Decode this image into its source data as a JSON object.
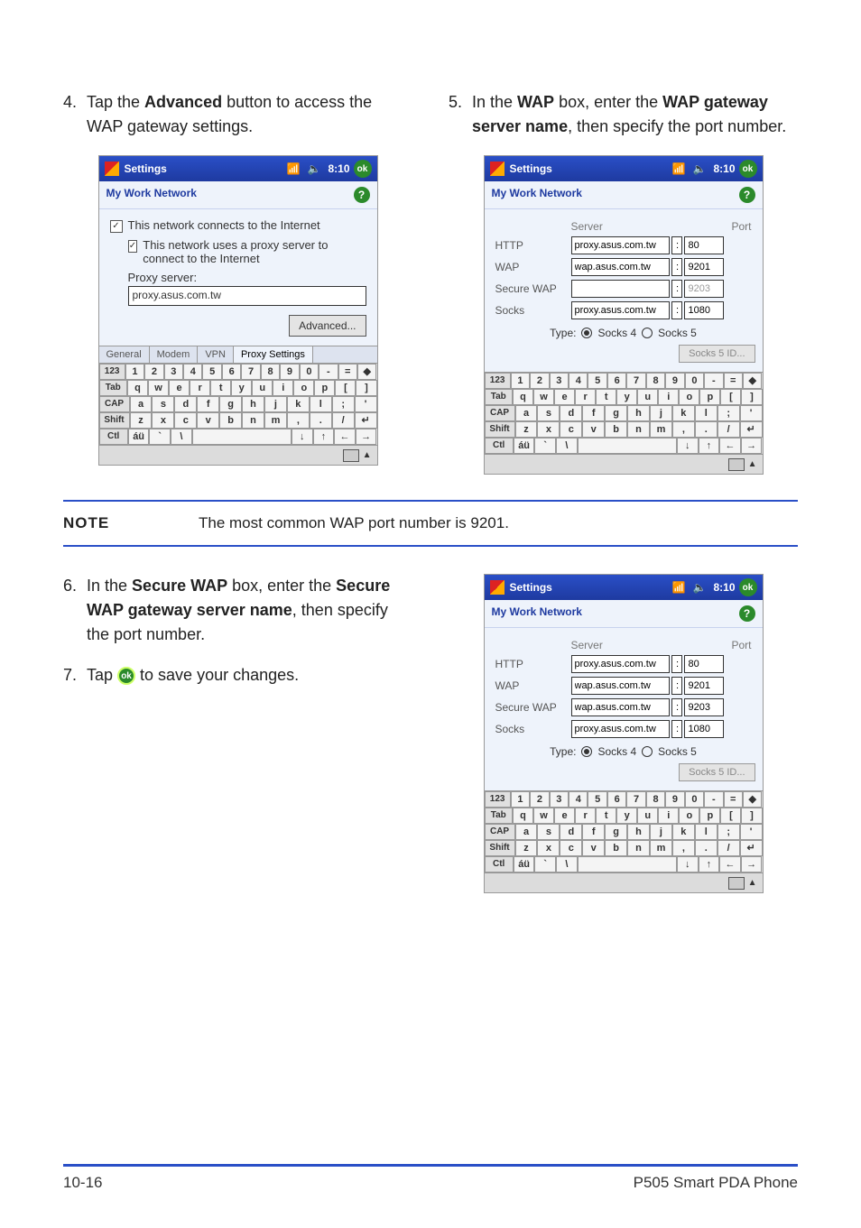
{
  "steps": {
    "s4": {
      "num": "4.",
      "pre": "Tap the ",
      "bold": "Advanced",
      "post": " button to access the WAP gateway settings."
    },
    "s5": {
      "num": "5.",
      "pre1": "In the ",
      "bold1": "WAP",
      "mid": " box, enter the ",
      "bold2": "WAP gateway server name",
      "post": ", then specify the port number."
    },
    "s6": {
      "num": "6.",
      "pre1": "In the ",
      "bold1": "Secure WAP",
      "mid": " box, enter the ",
      "bold2": "Secure WAP gateway server name",
      "post": ", then specify the port number."
    },
    "s7": {
      "num": "7.",
      "pre": "Tap ",
      "post": " to save your changes."
    }
  },
  "note": {
    "label": "NOTE",
    "text": "The most common WAP port number is 9201."
  },
  "titlebar": {
    "title": "Settings",
    "time": "8:10",
    "ok": "ok"
  },
  "subhead": {
    "title": "My Work Network",
    "help": "?"
  },
  "ss1": {
    "chk1": "This network connects to the Internet",
    "chk2": "This network uses a proxy server to connect to the Internet",
    "proxy_label": "Proxy server:",
    "proxy_value": "proxy.asus.com.tw",
    "advanced": "Advanced...",
    "tabs": {
      "t1": "General",
      "t2": "Modem",
      "t3": "VPN",
      "t4": "Proxy Settings"
    }
  },
  "proxyform": {
    "hdr_server": "Server",
    "hdr_port": "Port",
    "rows": {
      "http": {
        "label": "HTTP",
        "server": "proxy.asus.com.tw",
        "port": "80"
      },
      "wap": {
        "label": "WAP",
        "server": "wap.asus.com.tw",
        "port": "9201"
      },
      "secwap": {
        "label": "Secure WAP",
        "server": "",
        "port": "9203"
      },
      "secwap2": {
        "server": "wap.asus.com.tw",
        "port": "9203"
      },
      "socks": {
        "label": "Socks",
        "server": "proxy.asus.com.tw",
        "port": "1080"
      }
    },
    "colon": ":",
    "type_label": "Type:",
    "r1": "Socks 4",
    "r2": "Socks 5",
    "socks_btn": "Socks 5 ID..."
  },
  "kbd": {
    "r1": [
      "123",
      "1",
      "2",
      "3",
      "4",
      "5",
      "6",
      "7",
      "8",
      "9",
      "0",
      "-",
      "=",
      "◆"
    ],
    "r2": [
      "Tab",
      "q",
      "w",
      "e",
      "r",
      "t",
      "y",
      "u",
      "i",
      "o",
      "p",
      "[",
      "]"
    ],
    "r3": [
      "CAP",
      "a",
      "s",
      "d",
      "f",
      "g",
      "h",
      "j",
      "k",
      "l",
      ";",
      "'"
    ],
    "r4": [
      "Shift",
      "z",
      "x",
      "c",
      "v",
      "b",
      "n",
      "m",
      ",",
      ".",
      "/",
      "↵"
    ],
    "r5": [
      "Ctl",
      "áü",
      "`",
      "\\",
      " ",
      "↓",
      "↑",
      "←",
      "→"
    ]
  },
  "footer": {
    "left": "10-16",
    "right": "P505 Smart PDA Phone"
  }
}
